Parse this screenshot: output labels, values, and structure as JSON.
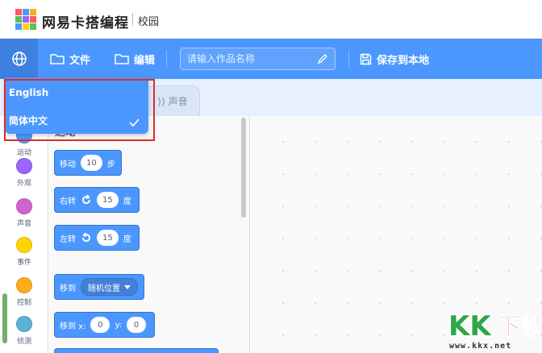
{
  "brand": {
    "name": "网易卡搭编程",
    "sub": "校园"
  },
  "menubar": {
    "language_icon": "globe-icon",
    "file_label": "文件",
    "edit_label": "编辑",
    "title_placeholder": "请输入作品名称",
    "save_label": "保存到本地"
  },
  "tabs": {
    "sound_label": "声音"
  },
  "language_menu": {
    "options": [
      {
        "label": "English",
        "selected": false
      },
      {
        "label": "简体中文",
        "selected": true
      }
    ]
  },
  "categories": [
    {
      "label": "运动",
      "color": "#4c97ff"
    },
    {
      "label": "外观",
      "color": "#9966ff"
    },
    {
      "label": "声音",
      "color": "#cf63cf"
    },
    {
      "label": "事件",
      "color": "#ffd500"
    },
    {
      "label": "控制",
      "color": "#ffab19"
    },
    {
      "label": "侦测",
      "color": "#5cb1d6"
    }
  ],
  "palette": {
    "section_title": "运动",
    "blocks": {
      "move": {
        "text": "移动",
        "value": "10",
        "suffix": "步"
      },
      "turn_right": {
        "text": "右转",
        "value": "15",
        "suffix": "度"
      },
      "turn_left": {
        "text": "左转",
        "value": "15",
        "suffix": "度"
      },
      "goto": {
        "text": "移到",
        "option": "随机位置"
      },
      "goto_xy": {
        "text": "移到 x:",
        "x": "0",
        "y_label": "y:",
        "y": "0"
      }
    }
  },
  "watermark": {
    "url": "www.kkx.net"
  }
}
